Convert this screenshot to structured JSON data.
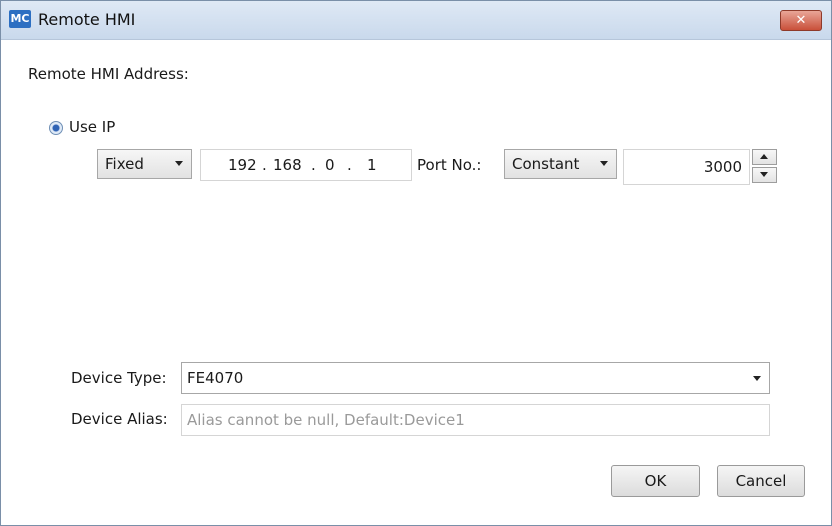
{
  "window": {
    "icon_text": "MC",
    "title": "Remote HMI",
    "close_glyph": "✕"
  },
  "address_label": "Remote HMI Address:",
  "use_ip": {
    "label": "Use IP",
    "selected": true
  },
  "ip_mode": {
    "value": "Fixed"
  },
  "ip": {
    "octet1": "192",
    "octet2": "168",
    "octet3": "0",
    "octet4": "1",
    "separator": "."
  },
  "port": {
    "label": "Port No.:",
    "mode": "Constant",
    "value": "3000"
  },
  "device_type": {
    "label": "Device Type:",
    "value": "FE4070"
  },
  "device_alias": {
    "label": "Device Alias:",
    "placeholder": "Alias cannot be null, Default:Device1"
  },
  "buttons": {
    "ok": "OK",
    "cancel": "Cancel"
  },
  "colors": {
    "title_bar": "#d3e1f1",
    "close": "#c9503a",
    "radio": "#2f63b5"
  }
}
